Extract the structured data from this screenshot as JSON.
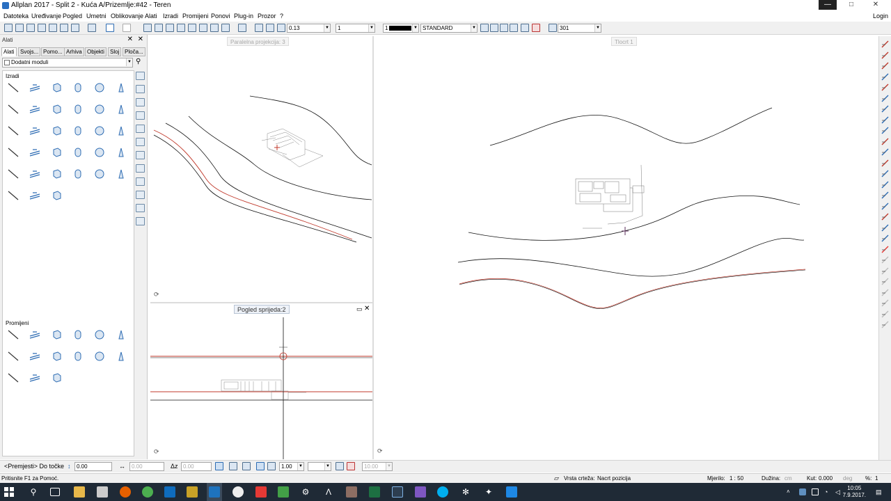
{
  "window": {
    "title": "Allplan 2017 - Split 2 - Kuća A/Prizemlje:#42 - Teren",
    "min": "—",
    "restore": "□",
    "close": "✕"
  },
  "menu": [
    "Datoteka",
    "Uređivanje",
    "Pogled",
    "Umetni",
    "Oblikovanje",
    "Alati",
    "Izradi",
    "Promijeni",
    "Ponovi",
    "Plug-in",
    "Prozor",
    "?"
  ],
  "login": "Login",
  "toolbar": {
    "pen": "0.13",
    "line": "1",
    "color": "1",
    "layer": "STANDARD",
    "pattern": "301"
  },
  "palette": {
    "header": "Alati",
    "tabs": [
      "Alati",
      "Svojs...",
      "Pomo...",
      "Arhiva",
      "Objekti",
      "Sloj",
      "Ploča..."
    ],
    "module": "Dodatni moduli",
    "section_create": "Izradi",
    "section_modify": "Promijeni"
  },
  "viewports": {
    "parallel": "Paralelna projekcija: 3",
    "front": "Pogled sprijeda:2",
    "plan": "Tlocrt 1"
  },
  "inputline": {
    "prompt": "<Premjesti> Do točke",
    "dx": "0.00",
    "dy": "0.00",
    "dz_label": "Δz",
    "dz": "0.00",
    "scale": "1.00",
    "angle": "10.00"
  },
  "status": {
    "help": "Pritisnite F1 za Pomoć.",
    "view_type_label": "Vrsta crteža:",
    "view_type": "Nacrt pozicija",
    "scale_label": "Mjerilo:",
    "scale": "1 : 50",
    "length_label": "Dužina:",
    "length_unit": "cm",
    "angle_label": "Kut:",
    "angle": "0.000",
    "angle_unit": "deg",
    "pct_label": "%:",
    "pct": "1"
  },
  "taskbar": {
    "time": "10:05",
    "date": "7.9.2017."
  },
  "colors": {
    "accent": "#2a6fc1",
    "red_line": "#c0392b",
    "taskbar": "#1f2a36"
  }
}
